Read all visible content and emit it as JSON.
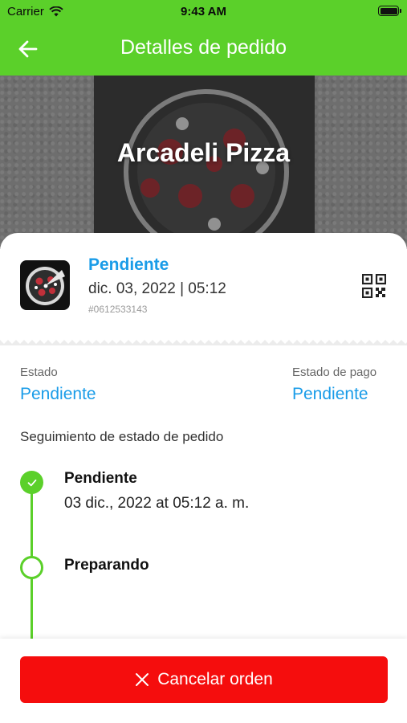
{
  "status_bar": {
    "carrier": "Carrier",
    "time": "9:43 AM"
  },
  "nav": {
    "title": "Detalles de pedido",
    "back_icon": "arrow-left-icon"
  },
  "hero": {
    "restaurant_name": "Arcadeli Pizza"
  },
  "order": {
    "status": "Pendiente",
    "date": "dic. 03, 2022 | 05:12",
    "number": "#0612533143",
    "qr_icon": "qr-code-icon"
  },
  "details": {
    "state_label": "Estado",
    "state_value": "Pendiente",
    "payment_label": "Estado de pago",
    "payment_value": "Pendiente"
  },
  "tracking": {
    "title": "Seguimiento de estado de pedido",
    "steps": [
      {
        "title": "Pendiente",
        "subtitle": "03 dic., 2022 at 05:12 a. m.",
        "done": true
      },
      {
        "title": "Preparando",
        "subtitle": "",
        "done": false
      }
    ]
  },
  "actions": {
    "cancel_label": "Cancelar orden",
    "cancel_icon": "close-icon"
  },
  "colors": {
    "brand_green": "#5bd02a",
    "status_blue": "#1a9ce8",
    "danger_red": "#f50d0d"
  }
}
